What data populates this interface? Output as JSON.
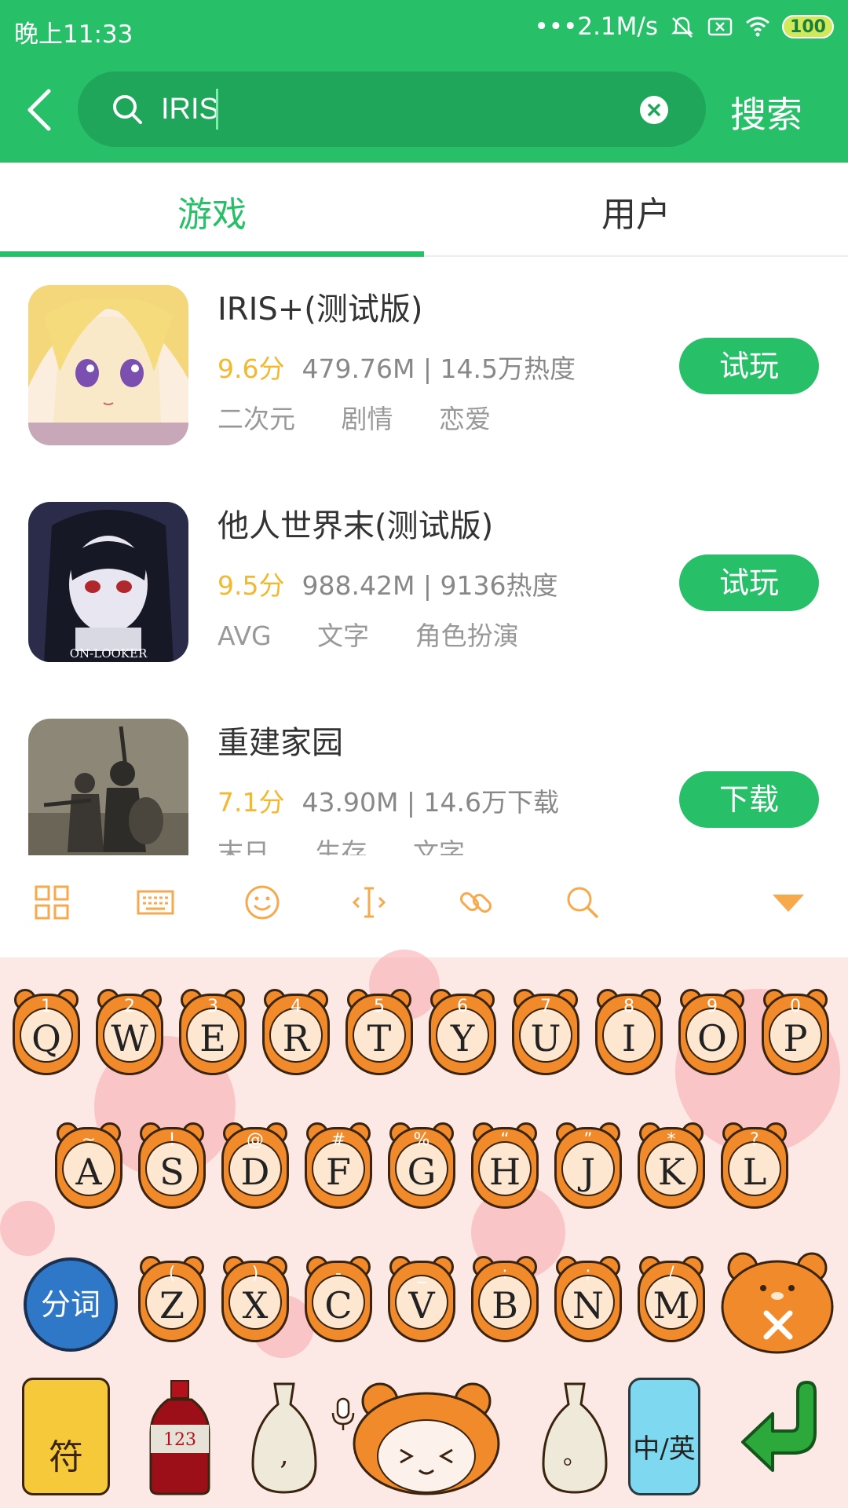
{
  "status_bar": {
    "time": "晚上11:33",
    "speed": "•••2.1M/s",
    "battery": "100"
  },
  "header": {
    "search_value": "IRIS",
    "search_button": "搜索"
  },
  "tabs": [
    {
      "label": "游戏",
      "active": true
    },
    {
      "label": "用户",
      "active": false
    }
  ],
  "games": [
    {
      "title": "IRIS+(测试版)",
      "score": "9.6分",
      "meta": "479.76M | 14.5万热度",
      "tags": [
        "二次元",
        "剧情",
        "恋爱"
      ],
      "action": "试玩"
    },
    {
      "title": "他人世界末(测试版)",
      "score": "9.5分",
      "meta": "988.42M | 9136热度",
      "tags": [
        "AVG",
        "文字",
        "角色扮演"
      ],
      "action": "试玩",
      "thumb_caption": "ON-LOOKER"
    },
    {
      "title": "重建家园",
      "score": "7.1分",
      "meta": "43.90M | 14.6万下载",
      "tags": [
        "末日",
        "生存",
        "文字"
      ],
      "action": "下载"
    }
  ],
  "keyboard": {
    "row1": [
      {
        "main": "Q",
        "sub": "1"
      },
      {
        "main": "W",
        "sub": "2"
      },
      {
        "main": "E",
        "sub": "3"
      },
      {
        "main": "R",
        "sub": "4"
      },
      {
        "main": "T",
        "sub": "5"
      },
      {
        "main": "Y",
        "sub": "6"
      },
      {
        "main": "U",
        "sub": "7"
      },
      {
        "main": "I",
        "sub": "8"
      },
      {
        "main": "O",
        "sub": "9"
      },
      {
        "main": "P",
        "sub": "0"
      }
    ],
    "row2": [
      {
        "main": "A",
        "sub": "~"
      },
      {
        "main": "S",
        "sub": "!"
      },
      {
        "main": "D",
        "sub": "@"
      },
      {
        "main": "F",
        "sub": "#"
      },
      {
        "main": "G",
        "sub": "%"
      },
      {
        "main": "H",
        "sub": "“"
      },
      {
        "main": "J",
        "sub": "”"
      },
      {
        "main": "K",
        "sub": "*"
      },
      {
        "main": "L",
        "sub": "?"
      }
    ],
    "row3": [
      {
        "main": "Z",
        "sub": "("
      },
      {
        "main": "X",
        "sub": ")"
      },
      {
        "main": "C",
        "sub": "-"
      },
      {
        "main": "V",
        "sub": "_"
      },
      {
        "main": "B",
        "sub": ":"
      },
      {
        "main": "N",
        "sub": ";"
      },
      {
        "main": "M",
        "sub": "/"
      }
    ],
    "fenci": "分词",
    "symbol_key": "符",
    "num_key": "123",
    "comma_key": ",",
    "period_key": "。",
    "lang_key": "中/英"
  },
  "colors": {
    "brand_green": "#27c069",
    "score_yellow": "#f2b830",
    "key_orange": "#f08a2a",
    "toolbar_orange": "#f6a94d"
  }
}
